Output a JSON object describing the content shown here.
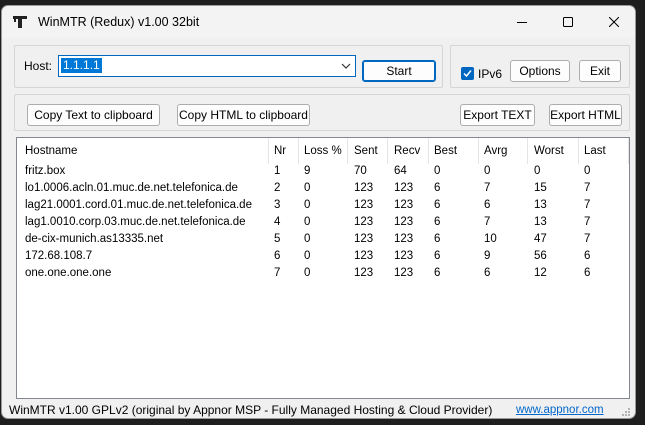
{
  "window": {
    "title": "WinMTR (Redux) v1.00 32bit"
  },
  "host": {
    "label": "Host:",
    "value": "1.1.1.1"
  },
  "buttons": {
    "start": "Start",
    "ipv6_label": "IPv6",
    "options": "Options",
    "exit": "Exit",
    "copy_text": "Copy Text to clipboard",
    "copy_html": "Copy HTML to clipboard",
    "export_text": "Export TEXT",
    "export_html": "Export HTML"
  },
  "ipv6_checked": true,
  "table": {
    "columns": [
      "Hostname",
      "Nr",
      "Loss %",
      "Sent",
      "Recv",
      "Best",
      "Avrg",
      "Worst",
      "Last"
    ],
    "rows": [
      [
        "fritz.box",
        "1",
        "9",
        "70",
        "64",
        "0",
        "0",
        "0",
        "0"
      ],
      [
        "lo1.0006.acln.01.muc.de.net.telefonica.de",
        "2",
        "0",
        "123",
        "123",
        "6",
        "7",
        "15",
        "7"
      ],
      [
        "lag21.0001.cord.01.muc.de.net.telefonica.de",
        "3",
        "0",
        "123",
        "123",
        "6",
        "6",
        "13",
        "7"
      ],
      [
        "lag1.0010.corp.03.muc.de.net.telefonica.de",
        "4",
        "0",
        "123",
        "123",
        "6",
        "7",
        "13",
        "7"
      ],
      [
        "de-cix-munich.as13335.net",
        "5",
        "0",
        "123",
        "123",
        "6",
        "10",
        "47",
        "7"
      ],
      [
        "172.68.108.7",
        "6",
        "0",
        "123",
        "123",
        "6",
        "9",
        "56",
        "6"
      ],
      [
        "one.one.one.one",
        "7",
        "0",
        "123",
        "123",
        "6",
        "6",
        "12",
        "6"
      ]
    ]
  },
  "status": {
    "text": "WinMTR v1.00 GPLv2 (original by Appnor MSP - Fully Managed Hosting & Cloud Provider)",
    "link": "www.appnor.com"
  },
  "icons": [
    "app-icon",
    "minimize-icon",
    "maximize-icon",
    "close-icon",
    "chevron-down-icon",
    "checkmark-icon",
    "resize-grip-icon"
  ]
}
